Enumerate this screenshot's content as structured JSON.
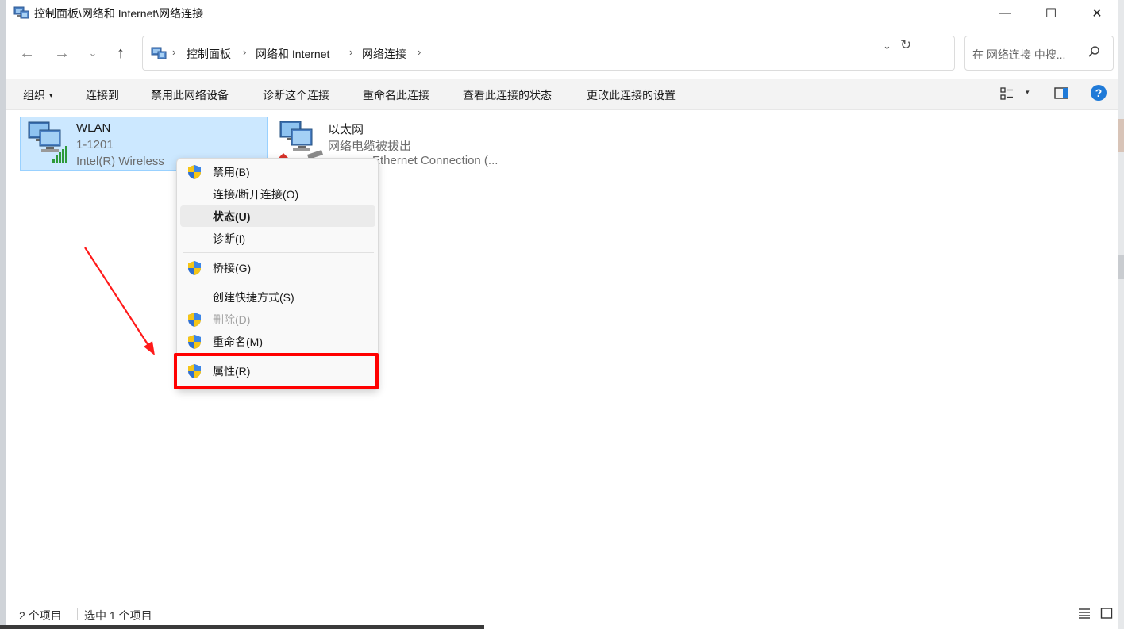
{
  "window": {
    "title": "控制面板\\网络和 Internet\\网络连接",
    "controls": {
      "minimize": "—",
      "maximize": "☐",
      "close": "✕"
    }
  },
  "nav": {
    "back": "←",
    "forward": "→",
    "recent": "⌄",
    "up": "↑",
    "breadcrumbs": [
      "控制面板",
      "网络和 Internet",
      "网络连接"
    ],
    "separator": "›",
    "dropdown": "⌄",
    "refresh": "↻"
  },
  "search": {
    "placeholder": "在 网络连接 中搜...",
    "icon": "search-icon"
  },
  "toolbar": {
    "organize": "组织",
    "connect_to": "连接到",
    "disable": "禁用此网络设备",
    "diagnose": "诊断这个连接",
    "rename": "重命名此连接",
    "view_status": "查看此连接的状态",
    "change_settings": "更改此连接的设置",
    "caret": "▾",
    "help": "?"
  },
  "connections": [
    {
      "name": "WLAN",
      "status": "1-1201",
      "device": "Intel(R) Wireless",
      "selected": true,
      "icon": "wifi-network-icon"
    },
    {
      "name": "以太网",
      "status": "网络电缆被拔出",
      "device": "Ethernet Connection (...",
      "selected": false,
      "icon": "ethernet-network-icon"
    }
  ],
  "context_menu": {
    "items": [
      {
        "label": "禁用(B)",
        "shield": true
      },
      {
        "label": "连接/断开连接(O)",
        "shield": false
      },
      {
        "label": "状态(U)",
        "shield": false,
        "bold": true,
        "hover": true
      },
      {
        "label": "诊断(I)",
        "shield": false
      },
      {
        "label": "桥接(G)",
        "shield": true
      },
      {
        "label": "创建快捷方式(S)",
        "shield": false
      },
      {
        "label": "删除(D)",
        "shield": true,
        "disabled": true
      },
      {
        "label": "重命名(M)",
        "shield": true
      },
      {
        "label": "属性(R)",
        "shield": true,
        "highlighted": true
      }
    ]
  },
  "status_bar": {
    "item_count": "2 个项目",
    "selected_count": "选中 1 个项目"
  },
  "colors": {
    "selection": "#cce8ff",
    "annotation": "#ff0000",
    "accent": "#1f7ad8"
  }
}
